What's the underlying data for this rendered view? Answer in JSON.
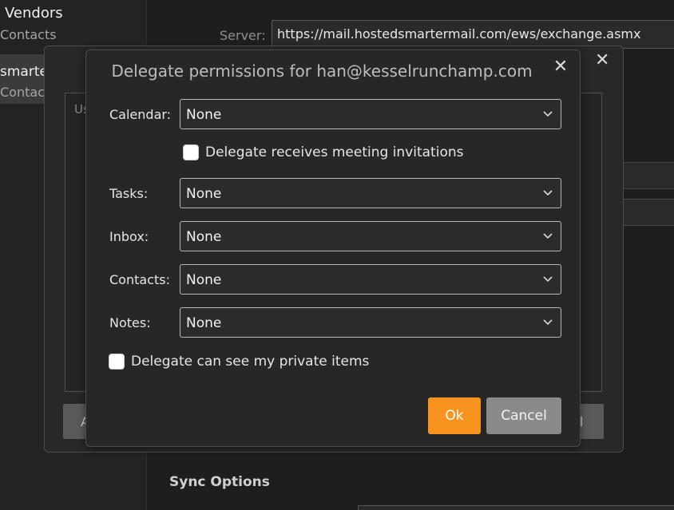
{
  "background": {
    "sidebar": {
      "title": "Vendors",
      "title_subtitle": "Contacts",
      "selected_title": "smarte",
      "selected_subtitle": "Contact"
    },
    "server_label": "Server:",
    "server_url": "https://mail.hostedsmartermail.com/ews/exchange.asmx",
    "sync_options_label": "Sync Options"
  },
  "underlying_dialog": {
    "list_header": "Us",
    "left_button_label": "A",
    "right_button_label": "el"
  },
  "dialog": {
    "title": "Delegate permissions for han@kesselrunchamp.com",
    "close_glyph": "✕",
    "rows": {
      "calendar": {
        "label": "Calendar:",
        "value": "None"
      },
      "tasks": {
        "label": "Tasks:",
        "value": "None"
      },
      "inbox": {
        "label": "Inbox:",
        "value": "None"
      },
      "contacts": {
        "label": "Contacts:",
        "value": "None"
      },
      "notes": {
        "label": "Notes:",
        "value": "None"
      }
    },
    "meeting_invitations_label": "Delegate receives meeting invitations",
    "private_items_label": "Delegate can see my private items",
    "ok_label": "Ok",
    "cancel_label": "Cancel"
  },
  "colors": {
    "accent_ok": "#f7931e",
    "cancel_button": "#8a8a8a",
    "dialog_background": "#272727"
  }
}
